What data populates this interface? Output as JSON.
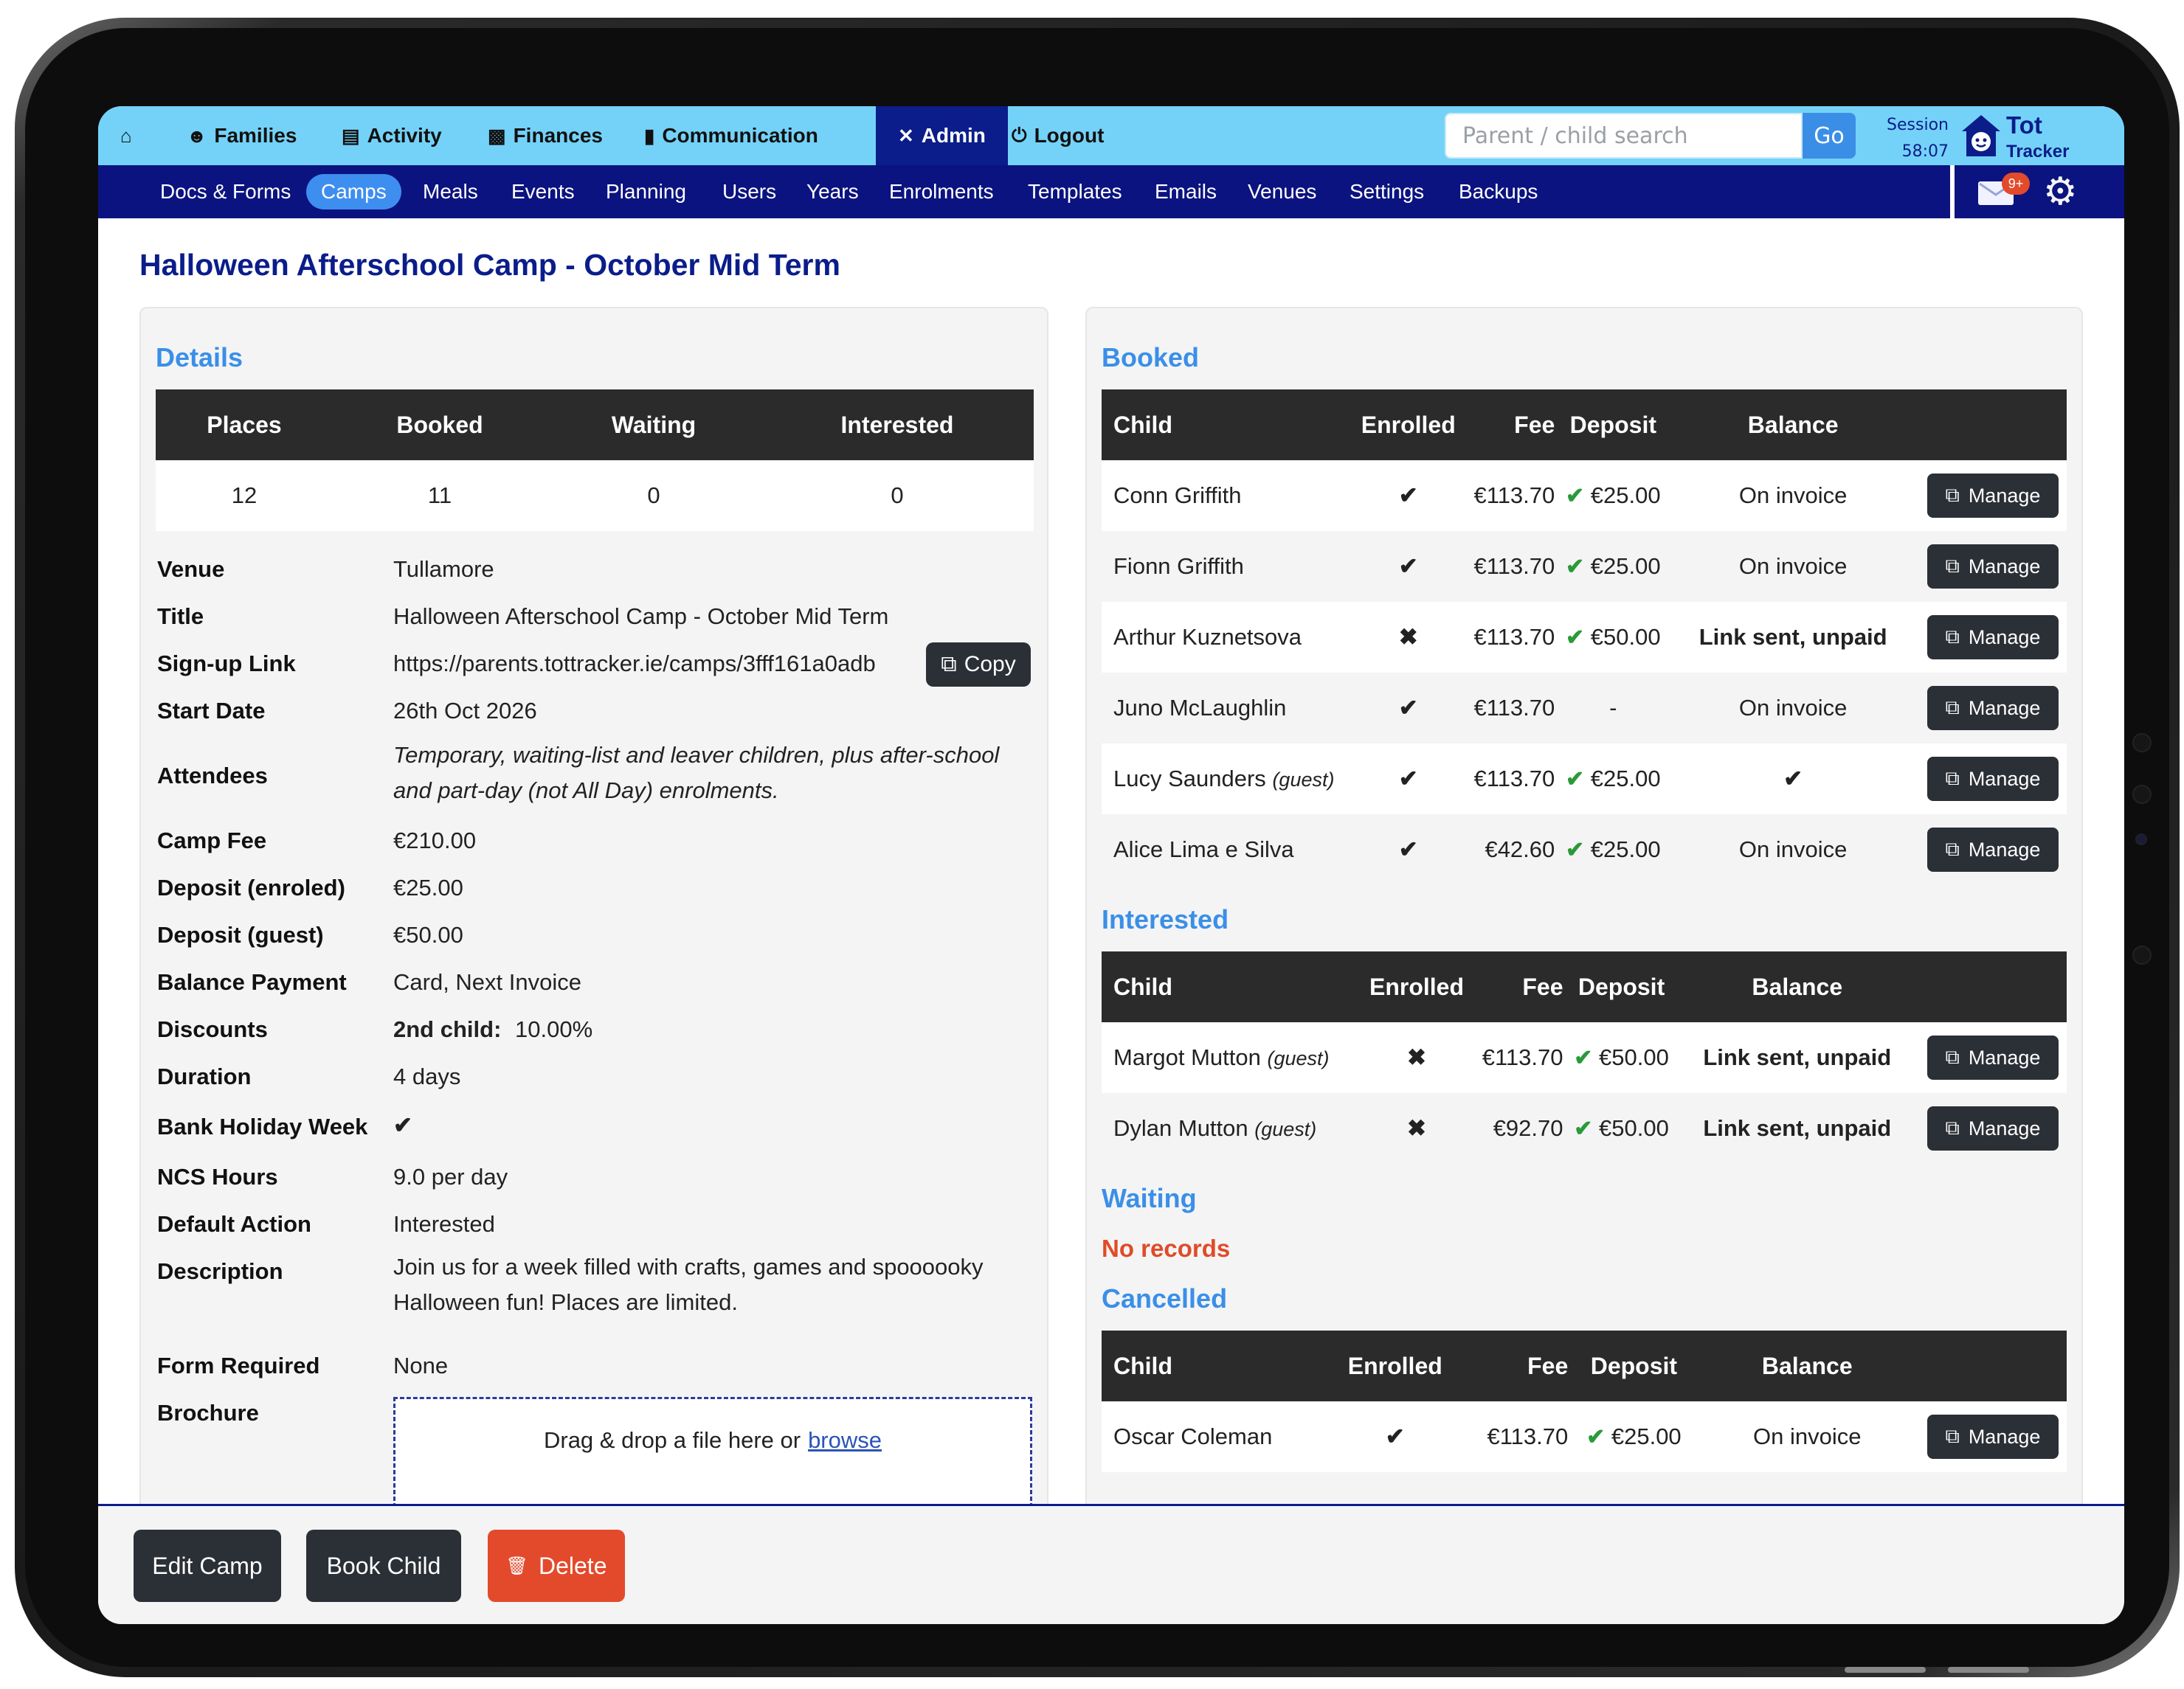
{
  "topnav": {
    "items": [
      {
        "label": "",
        "icon": "home-icon"
      },
      {
        "label": "Families",
        "icon": "user-icon"
      },
      {
        "label": "Activity",
        "icon": "clipboard-icon"
      },
      {
        "label": "Finances",
        "icon": "cash-icon"
      },
      {
        "label": "Communication",
        "icon": "chat-icon"
      },
      {
        "label": "Admin",
        "icon": "tools-icon"
      },
      {
        "label": "Logout",
        "icon": "power-icon"
      }
    ],
    "search_placeholder": "Parent / child search",
    "go_label": "Go",
    "session_label": "Session",
    "session_time": "58:07",
    "logo_line1": "Tot",
    "logo_line2": "Tracker"
  },
  "subnav": {
    "items": [
      "Docs & Forms",
      "Camps",
      "Meals",
      "Events",
      "Planning",
      "Users",
      "Years",
      "Enrolments",
      "Templates",
      "Emails",
      "Venues",
      "Settings",
      "Backups"
    ],
    "active": "Camps",
    "mail_badge": "9+"
  },
  "page": {
    "title": "Halloween Afterschool Camp - October Mid Term"
  },
  "details": {
    "heading": "Details",
    "summary_headers": [
      "Places",
      "Booked",
      "Waiting",
      "Interested"
    ],
    "summary_values": [
      "12",
      "11",
      "0",
      "0"
    ],
    "fields": {
      "venue_label": "Venue",
      "venue": "Tullamore",
      "title_label": "Title",
      "title": "Halloween Afterschool Camp - October Mid Term",
      "signup_label": "Sign-up Link",
      "signup": "https://parents.tottracker.ie/camps/3fff161a0adb",
      "copy_label": "Copy",
      "start_label": "Start Date",
      "start": "26th Oct 2026",
      "attendees_label": "Attendees",
      "attendees_line1": "Temporary, waiting-list and leaver children, plus after-school",
      "attendees_line2": "and part-day (not All Day) enrolments.",
      "fee_label": "Camp Fee",
      "fee": "€210.00",
      "dep_enr_label": "Deposit (enroled)",
      "dep_enr": "€25.00",
      "dep_guest_label": "Deposit (guest)",
      "dep_guest": "€50.00",
      "balance_label": "Balance Payment",
      "balance": "Card, Next Invoice",
      "discounts_label": "Discounts",
      "discounts_key": "2nd child:",
      "discounts_value": "10.00%",
      "duration_label": "Duration",
      "duration": "4 days",
      "bank_label": "Bank Holiday Week",
      "ncs_label": "NCS Hours",
      "ncs": "9.0 per day",
      "action_label": "Default Action",
      "action": "Interested",
      "desc_label": "Description",
      "desc_line1": "Join us for a week filled with crafts, games and spoooooky",
      "desc_line2": "Halloween fun! Places are limited.",
      "form_label": "Form Required",
      "form": "None",
      "brochure_label": "Brochure",
      "drop_text": "Drag & drop a file here or",
      "browse": "browse"
    }
  },
  "booked": {
    "heading": "Booked",
    "headers": [
      "Child",
      "Enrolled",
      "Fee",
      "Deposit",
      "Balance"
    ],
    "rows": [
      {
        "child": "Conn Griffith",
        "guest": "",
        "enrolled": "✔",
        "fee": "€113.70",
        "deposit": "€25.00",
        "balance": "On invoice",
        "manage": "Manage"
      },
      {
        "child": "Fionn Griffith",
        "guest": "",
        "enrolled": "✔",
        "fee": "€113.70",
        "deposit": "€25.00",
        "balance": "On invoice",
        "manage": "Manage"
      },
      {
        "child": "Arthur Kuznetsova",
        "guest": "",
        "enrolled": "✖",
        "fee": "€113.70",
        "deposit": "€50.00",
        "balance": "Link sent, unpaid",
        "manage": "Manage"
      },
      {
        "child": "Juno McLaughlin",
        "guest": "",
        "enrolled": "✔",
        "fee": "€113.70",
        "deposit": "-",
        "balance": "On invoice",
        "manage": "Manage"
      },
      {
        "child": "Lucy Saunders",
        "guest": "(guest)",
        "enrolled": "✔",
        "fee": "€113.70",
        "deposit": "€25.00",
        "balance": "✔",
        "manage": "Manage"
      },
      {
        "child": "Alice Lima e Silva",
        "guest": "",
        "enrolled": "✔",
        "fee": "€42.60",
        "deposit": "€25.00",
        "balance": "On invoice",
        "manage": "Manage"
      }
    ]
  },
  "interested": {
    "heading": "Interested",
    "headers": [
      "Child",
      "Enrolled",
      "Fee",
      "Deposit",
      "Balance"
    ],
    "rows": [
      {
        "child": "Margot Mutton",
        "guest": "(guest)",
        "enrolled": "✖",
        "fee": "€113.70",
        "deposit": "€50.00",
        "balance": "Link sent, unpaid",
        "manage": "Manage"
      },
      {
        "child": "Dylan Mutton",
        "guest": "(guest)",
        "enrolled": "✖",
        "fee": "€92.70",
        "deposit": "€50.00",
        "balance": "Link sent, unpaid",
        "manage": "Manage"
      }
    ]
  },
  "waiting": {
    "heading": "Waiting",
    "empty": "No records"
  },
  "cancelled": {
    "heading": "Cancelled",
    "headers": [
      "Child",
      "Enrolled",
      "Fee",
      "Deposit",
      "Balance"
    ],
    "rows": [
      {
        "child": "Oscar Coleman",
        "guest": "",
        "enrolled": "✔",
        "fee": "€113.70",
        "deposit": "€25.00",
        "balance": "On invoice",
        "manage": "Manage"
      }
    ]
  },
  "footer": {
    "edit": "Edit Camp",
    "book": "Book Child",
    "delete": "Delete"
  },
  "colors": {
    "nav_light": "#74d2f8",
    "nav_dark": "#0b1380",
    "title": "#0b1d8a",
    "section": "#3a8fe8",
    "success": "#2a9a39",
    "danger": "#e04b29",
    "dark_button": "#2b2f36"
  }
}
